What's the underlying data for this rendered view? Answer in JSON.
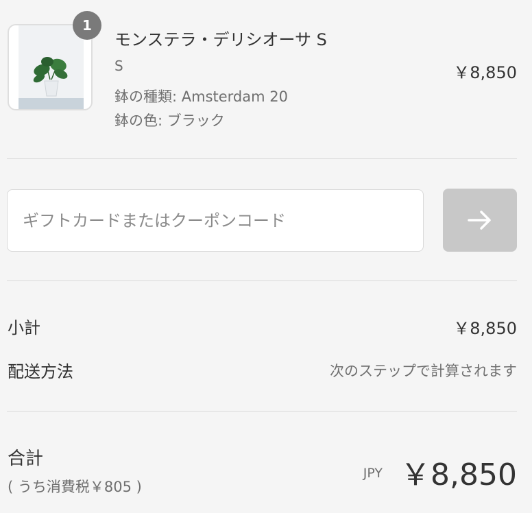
{
  "line_item": {
    "quantity": "1",
    "title": "モンステラ・デリシオーサ S",
    "variant": "S",
    "properties": [
      "鉢の種類: Amsterdam 20",
      "鉢の色: ブラック"
    ],
    "price": "￥8,850",
    "image_icon": "potted-plant-image"
  },
  "discount": {
    "placeholder": "ギフトカードまたはクーポンコード",
    "apply_icon": "arrow-right-icon"
  },
  "summary": {
    "subtotal_label": "小計",
    "subtotal_value": "￥8,850",
    "shipping_label": "配送方法",
    "shipping_value": "次のステップで計算されます"
  },
  "total": {
    "label": "合計",
    "tax_note": "( うち消費税￥805 )",
    "currency": "JPY",
    "amount": "￥8,850"
  },
  "colors": {
    "background": "#f5f5f5",
    "button_disabled": "#c8c8c8",
    "badge": "#7a7a7a",
    "divider": "#d9d9d9"
  }
}
